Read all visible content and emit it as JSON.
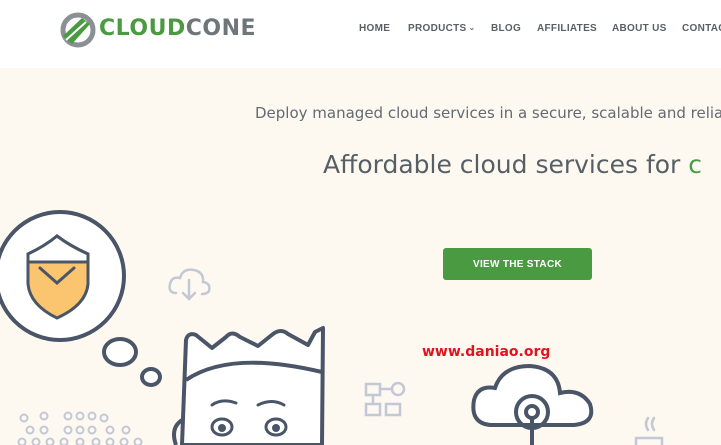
{
  "logo": {
    "part1": "CLOUD",
    "part2": "CONE"
  },
  "nav": {
    "items": [
      {
        "label": "HOME"
      },
      {
        "label": "PRODUCTS"
      },
      {
        "label": "BLOG"
      },
      {
        "label": "AFFILIATES"
      },
      {
        "label": "ABOUT US"
      },
      {
        "label": "CONTACT"
      }
    ],
    "products_caret": "chevron-down-icon"
  },
  "hero": {
    "subtitle": "Deploy managed cloud services in a secure, scalable and reliable",
    "headline": "Affordable cloud services for ",
    "headline_accent": "c",
    "cta_label": "VIEW THE STACK"
  },
  "watermark": "www.daniao.org",
  "colors": {
    "brand_green": "#4a9a42",
    "logo_gray": "#6f767a",
    "background": "#fdf9f1",
    "watermark_red": "#e0131f"
  }
}
